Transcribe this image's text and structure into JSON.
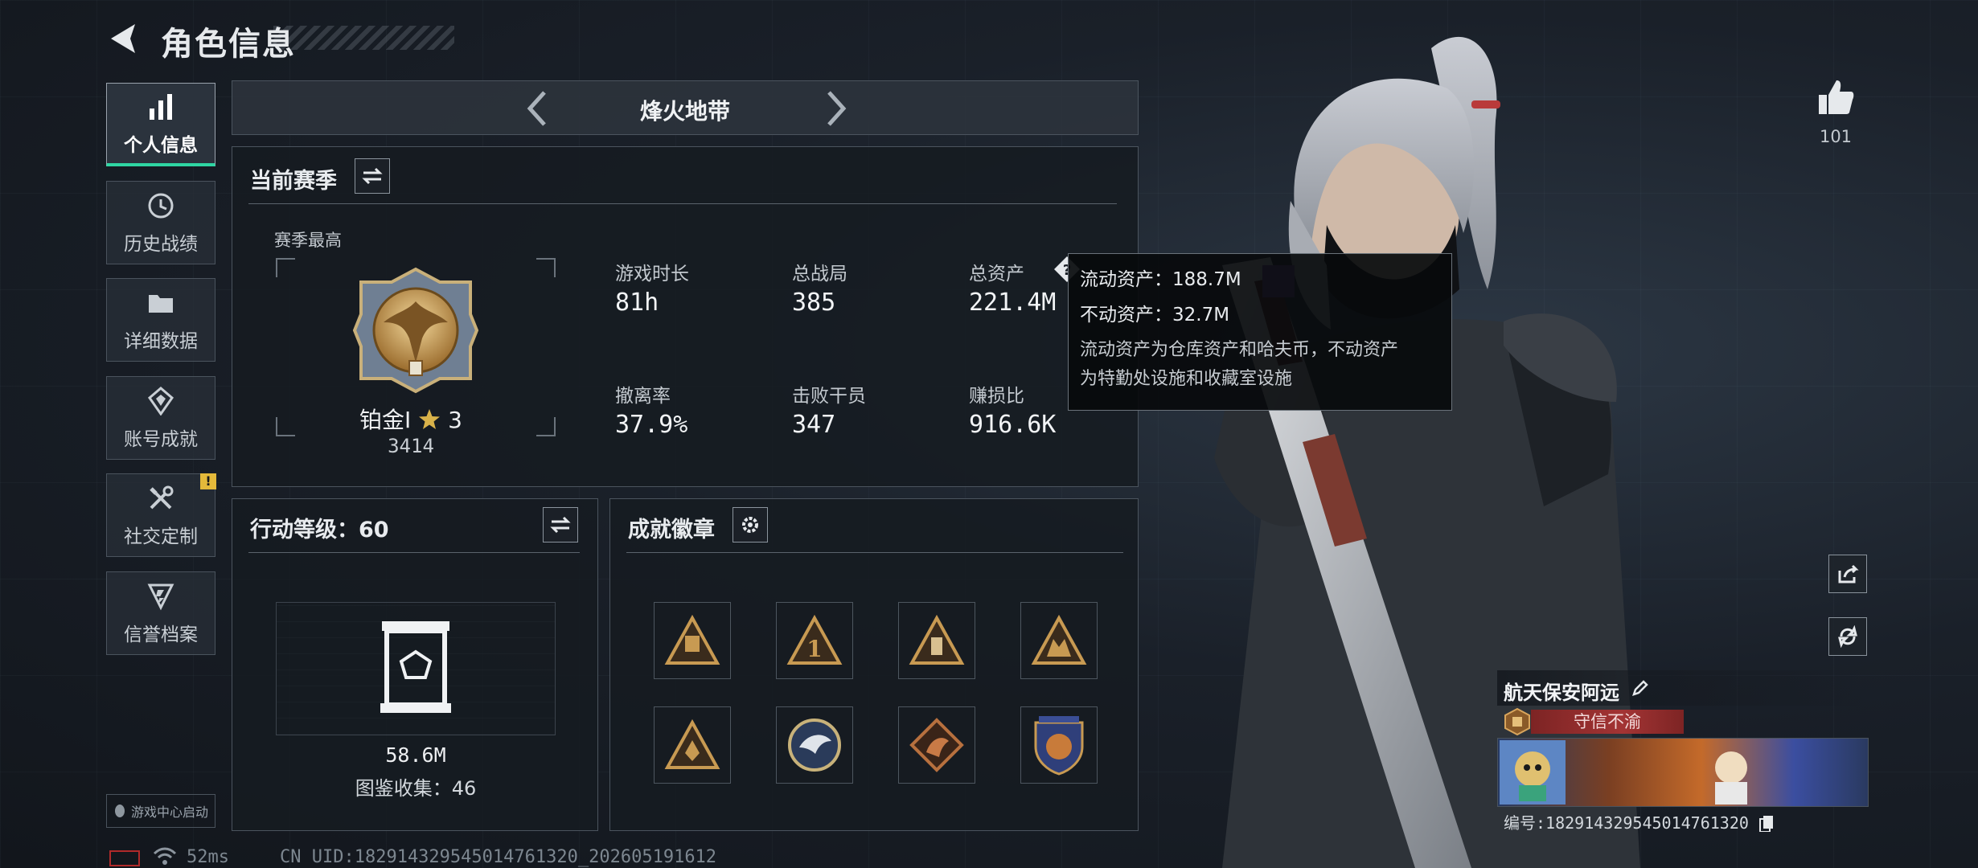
{
  "header": {
    "title": "角色信息"
  },
  "sidebar": {
    "items": [
      {
        "label": "个人信息",
        "icon": "bar-chart-icon",
        "active": true
      },
      {
        "label": "历史战绩",
        "icon": "history-icon"
      },
      {
        "label": "详细数据",
        "icon": "folder-icon"
      },
      {
        "label": "账号成就",
        "icon": "achievement-icon"
      },
      {
        "label": "社交定制",
        "icon": "tools-icon",
        "badge": "!"
      },
      {
        "label": "信誉档案",
        "icon": "credit-icon"
      }
    ],
    "game_center_label": "游戏中心启动"
  },
  "mode_nav": {
    "title": "烽火地带"
  },
  "season": {
    "title": "当前赛季",
    "best_label": "赛季最高",
    "rank_name": "铂金Ⅰ",
    "rank_stars": "3",
    "rank_score": "3414",
    "stats": [
      {
        "label": "游戏时长",
        "value": "81h"
      },
      {
        "label": "总战局",
        "value": "385"
      },
      {
        "label": "总资产",
        "value": "221.4M"
      },
      {
        "label": "撤离率",
        "value": "37.9%"
      },
      {
        "label": "击败干员",
        "value": "347"
      },
      {
        "label": "赚损比",
        "value": "916.6K"
      }
    ]
  },
  "tooltip": {
    "liquid": "流动资产：188.7M",
    "fixed": "不动资产：32.7M",
    "desc_line1": "流动资产为仓库资产和哈夫币，不动资产",
    "desc_line2": "为特勤处设施和收藏室设施"
  },
  "action_level": {
    "title": "行动等级：60",
    "value": "58.6M",
    "collection": "图鉴收集：46"
  },
  "achievements": {
    "title": "成就徽章",
    "badges": [
      "badge-1",
      "badge-2",
      "badge-3",
      "badge-4",
      "badge-5",
      "badge-6",
      "badge-7",
      "badge-8"
    ]
  },
  "profile": {
    "likes": "101",
    "player_name": "航天保安阿远",
    "title_tag": "守信不渝",
    "id_text": "编号:182914329545014761320"
  },
  "footer": {
    "ping": "52ms",
    "uid": "CN UID:182914329545014761320_202605191612"
  },
  "colors": {
    "accent": "#2fd6a3",
    "warning": "#e4b93a",
    "title_red": "#8e2a2a"
  }
}
